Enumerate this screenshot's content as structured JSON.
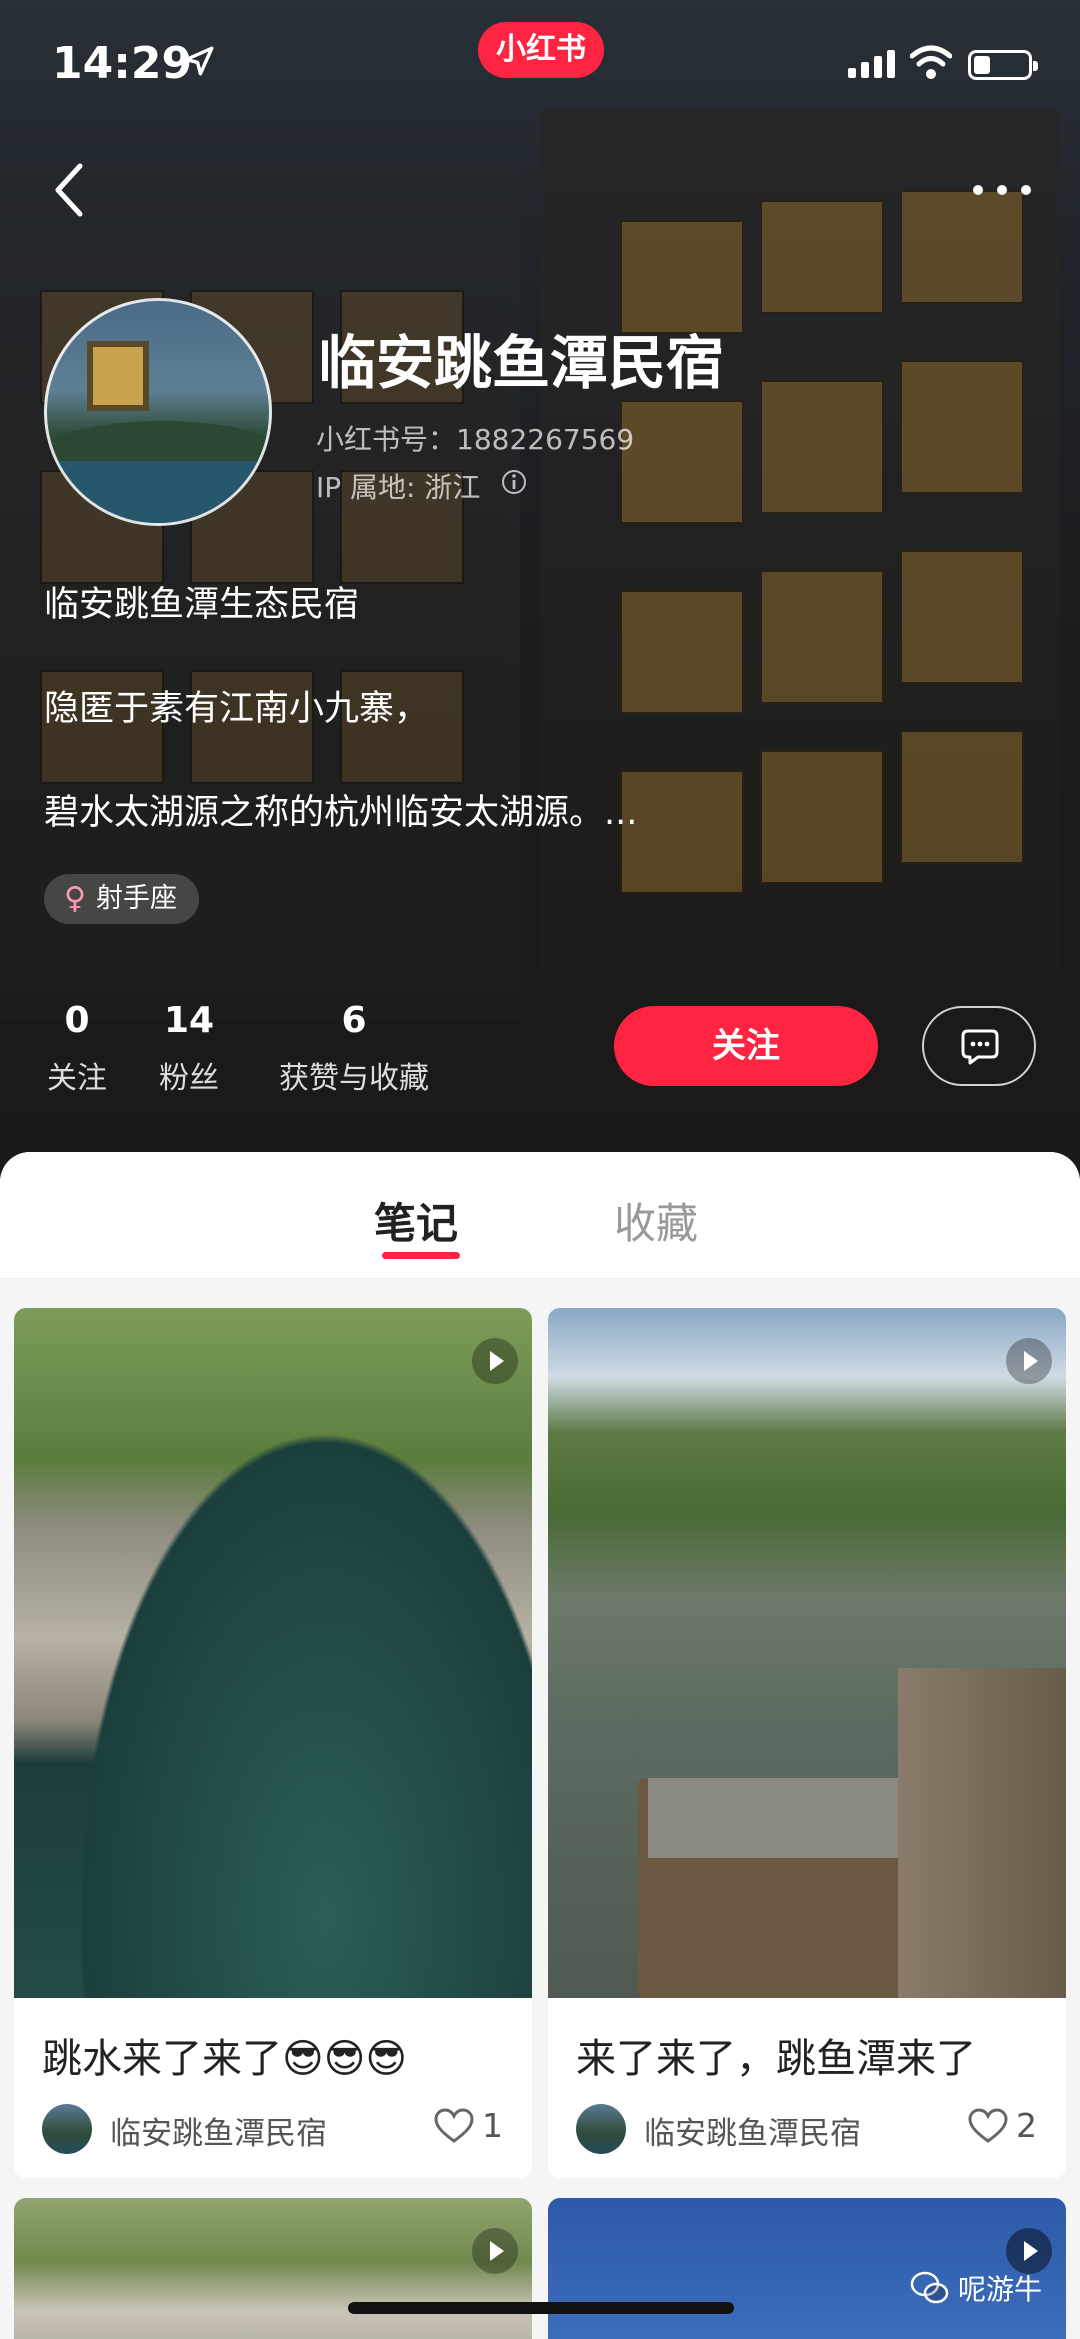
{
  "status_bar": {
    "time": "14:29"
  },
  "brand_badge": "小红书",
  "profile": {
    "name": "临安跳鱼潭民宿",
    "red_id": "小红书号：1882267569",
    "ip_location": "IP 属地: 浙江",
    "bio_lines": [
      "临安跳鱼潭生态民宿",
      "隐匿于素有江南小九寨，",
      "碧水太湖源之称的杭州临安太湖源。..."
    ],
    "tag": "射手座",
    "stats": [
      {
        "value": "0",
        "label": "关注"
      },
      {
        "value": "14",
        "label": "粉丝"
      },
      {
        "value": "6",
        "label": "获赞与收藏"
      }
    ],
    "follow_label": "关注"
  },
  "tabs": [
    {
      "label": "笔记",
      "active": true
    },
    {
      "label": "收藏",
      "active": false
    }
  ],
  "notes": [
    {
      "title": "跳水来了来了😎😎😎",
      "author": "临安跳鱼潭民宿",
      "likes": "1"
    },
    {
      "title": "来了来了，跳鱼潭来了",
      "author": "临安跳鱼潭民宿",
      "likes": "2"
    }
  ],
  "watermark": "呢游牛",
  "colors": {
    "accent": "#ff2442"
  }
}
